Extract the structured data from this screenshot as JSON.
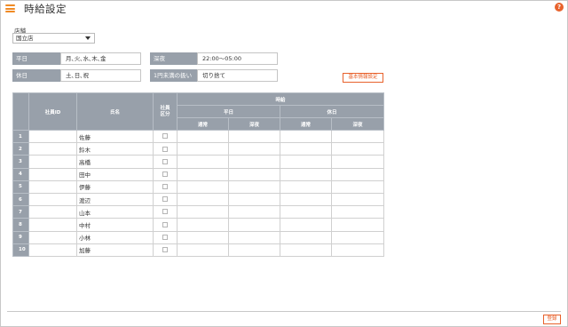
{
  "header": {
    "title": "時給設定",
    "help_label": "?"
  },
  "store": {
    "label": "店舗",
    "selected": "国立店"
  },
  "fields": {
    "weekday_label": "平日",
    "weekday_value": "月､火､水､木､金",
    "holiday_label": "休日",
    "holiday_value": "土､日､祝",
    "night_label": "深夜",
    "night_value": "22:00～05:00",
    "rounding_label": "1円未満の扱い",
    "rounding_value": "切り捨て"
  },
  "basic_info_button": "基本情報設定",
  "table": {
    "headers": {
      "employee_id": "社員ID",
      "name": "氏名",
      "employee_type": "社員\n区分",
      "hourly": "時給",
      "weekday": "平日",
      "holiday": "休日",
      "normal": "通常",
      "night": "深夜"
    },
    "rows": [
      {
        "no": "1",
        "name": "佐藤"
      },
      {
        "no": "2",
        "name": "鈴木"
      },
      {
        "no": "3",
        "name": "高橋"
      },
      {
        "no": "4",
        "name": "田中"
      },
      {
        "no": "5",
        "name": "伊藤"
      },
      {
        "no": "6",
        "name": "渡辺"
      },
      {
        "no": "7",
        "name": "山本"
      },
      {
        "no": "8",
        "name": "中村"
      },
      {
        "no": "9",
        "name": "小林"
      },
      {
        "no": "10",
        "name": "加藤"
      }
    ]
  },
  "footer": {
    "register_label": "登録"
  }
}
